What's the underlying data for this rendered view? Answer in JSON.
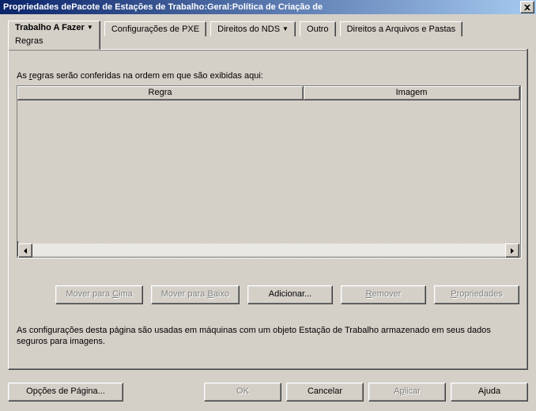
{
  "window": {
    "title": "Propriedades dePacote de Estações de Trabalho:Geral:Política de Criação de"
  },
  "tabs": {
    "active": {
      "label": "Trabalho A Fazer",
      "sublabel": "Regras"
    },
    "others": [
      {
        "label": "Configurações de PXE"
      },
      {
        "label": "Direitos do NDS",
        "has_dropdown": true
      },
      {
        "label": "Outro"
      },
      {
        "label": "Direitos a Arquivos e Pastas"
      }
    ]
  },
  "content": {
    "intro_pre": "As ",
    "intro_underline": "r",
    "intro_post": "egras serão conferidas na ordem em que são exibidas aqui:"
  },
  "columns": {
    "rule": "Regra",
    "image": "Imagem"
  },
  "buttons": {
    "move_up_pre": "Mover para ",
    "move_up_u": "C",
    "move_up_post": "ima",
    "move_down_pre": "Mover para ",
    "move_down_u": "B",
    "move_down_post": "aixo",
    "add": "Adicionar...",
    "remove_u": "R",
    "remove_post": "emover",
    "properties_u": "P",
    "properties_post": "ropriedades"
  },
  "footnote": "As configurações desta página são usadas em máquinas com um objeto Estação de Trabalho armazenado em seus dados seguros para imagens.",
  "page_options": {
    "pre": "Opções de Pá",
    "u": "g",
    "post": "ina..."
  },
  "footer": {
    "ok": "OK",
    "cancel": "Cancelar",
    "apply_pre": "A",
    "apply_u": "p",
    "apply_post": "licar",
    "help": "Ajuda"
  }
}
